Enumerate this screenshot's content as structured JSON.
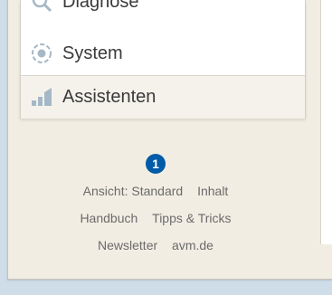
{
  "menu": {
    "items": [
      {
        "label": "Diagnose",
        "icon": "diagnose-icon"
      },
      {
        "label": "System",
        "icon": "system-icon"
      },
      {
        "label": "Assistenten",
        "icon": "assistant-icon"
      }
    ]
  },
  "footer": {
    "badge": "1",
    "row1": [
      "Ansicht: Standard",
      "Inhalt"
    ],
    "row2": [
      "Handbuch",
      "Tipps & Tricks"
    ],
    "row3": [
      "Newsletter",
      "avm.de"
    ]
  },
  "colors": {
    "accent": "#005ca8",
    "panel": "#f2ede3",
    "background": "#cfdde9"
  }
}
